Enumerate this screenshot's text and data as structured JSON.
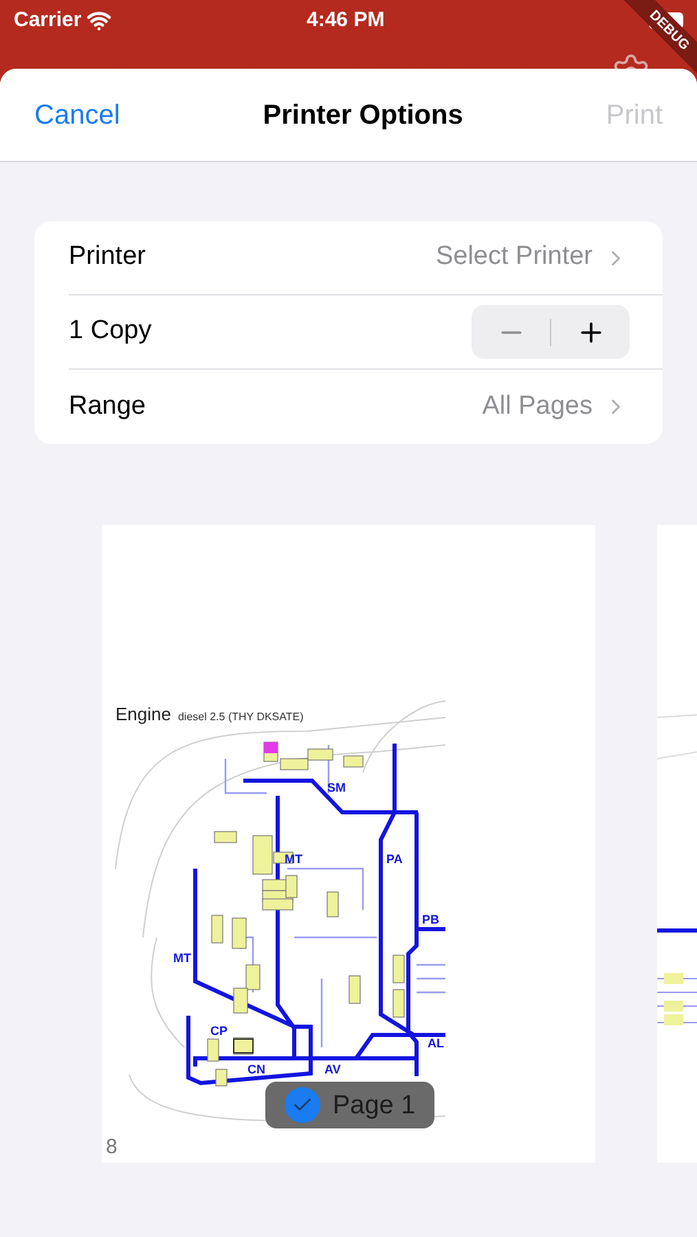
{
  "status_bar": {
    "carrier": "Carrier",
    "time": "4:46 PM"
  },
  "debug_banner": "DEBUG",
  "sheet": {
    "cancel": "Cancel",
    "title": "Printer Options",
    "print": {
      "label": "Print",
      "disabled": true
    }
  },
  "options": [
    {
      "kind": "link",
      "label": "Printer",
      "value": "Select Printer"
    },
    {
      "kind": "stepper",
      "label": "1 Copy"
    },
    {
      "kind": "link",
      "label": "Range",
      "value": "All Pages"
    }
  ],
  "preview": {
    "page": {
      "title": "Engine",
      "subtitle": "diesel 2.5 (THY DKSATE)",
      "labels": [
        "SM",
        "MT",
        "PA",
        "PB",
        "MT",
        "CP",
        "AL",
        "CN",
        "AV"
      ],
      "page_number": "8",
      "selected": true,
      "badge": "Page 1"
    }
  }
}
